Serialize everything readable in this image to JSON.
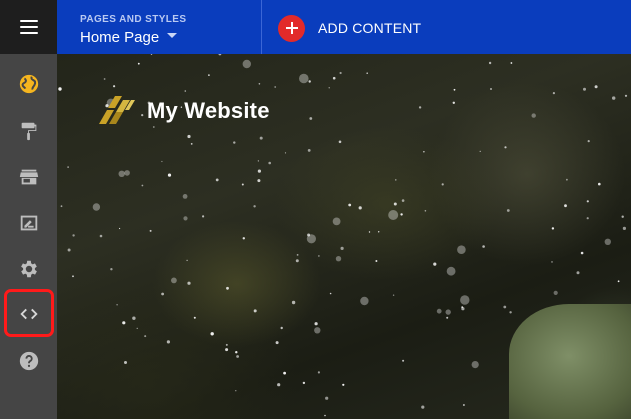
{
  "sidebar": {
    "items": [
      {
        "name": "globe-icon",
        "color": "#f5b51f"
      },
      {
        "name": "paint-roller-icon"
      },
      {
        "name": "store-icon"
      },
      {
        "name": "edit-note-icon"
      },
      {
        "name": "gear-icon"
      },
      {
        "name": "code-icon",
        "highlighted": true
      },
      {
        "name": "help-icon"
      }
    ]
  },
  "header": {
    "pages_caption": "PAGES AND STYLES",
    "current_page": "Home Page",
    "add_content_label": "ADD CONTENT"
  },
  "site": {
    "name": "My Website"
  },
  "colors": {
    "topbar": "#0a3dbd",
    "sidebar": "#454545",
    "accent_red": "#e22a2a",
    "highlight": "#ff1a1a",
    "logo_gold": "#c9a227"
  }
}
